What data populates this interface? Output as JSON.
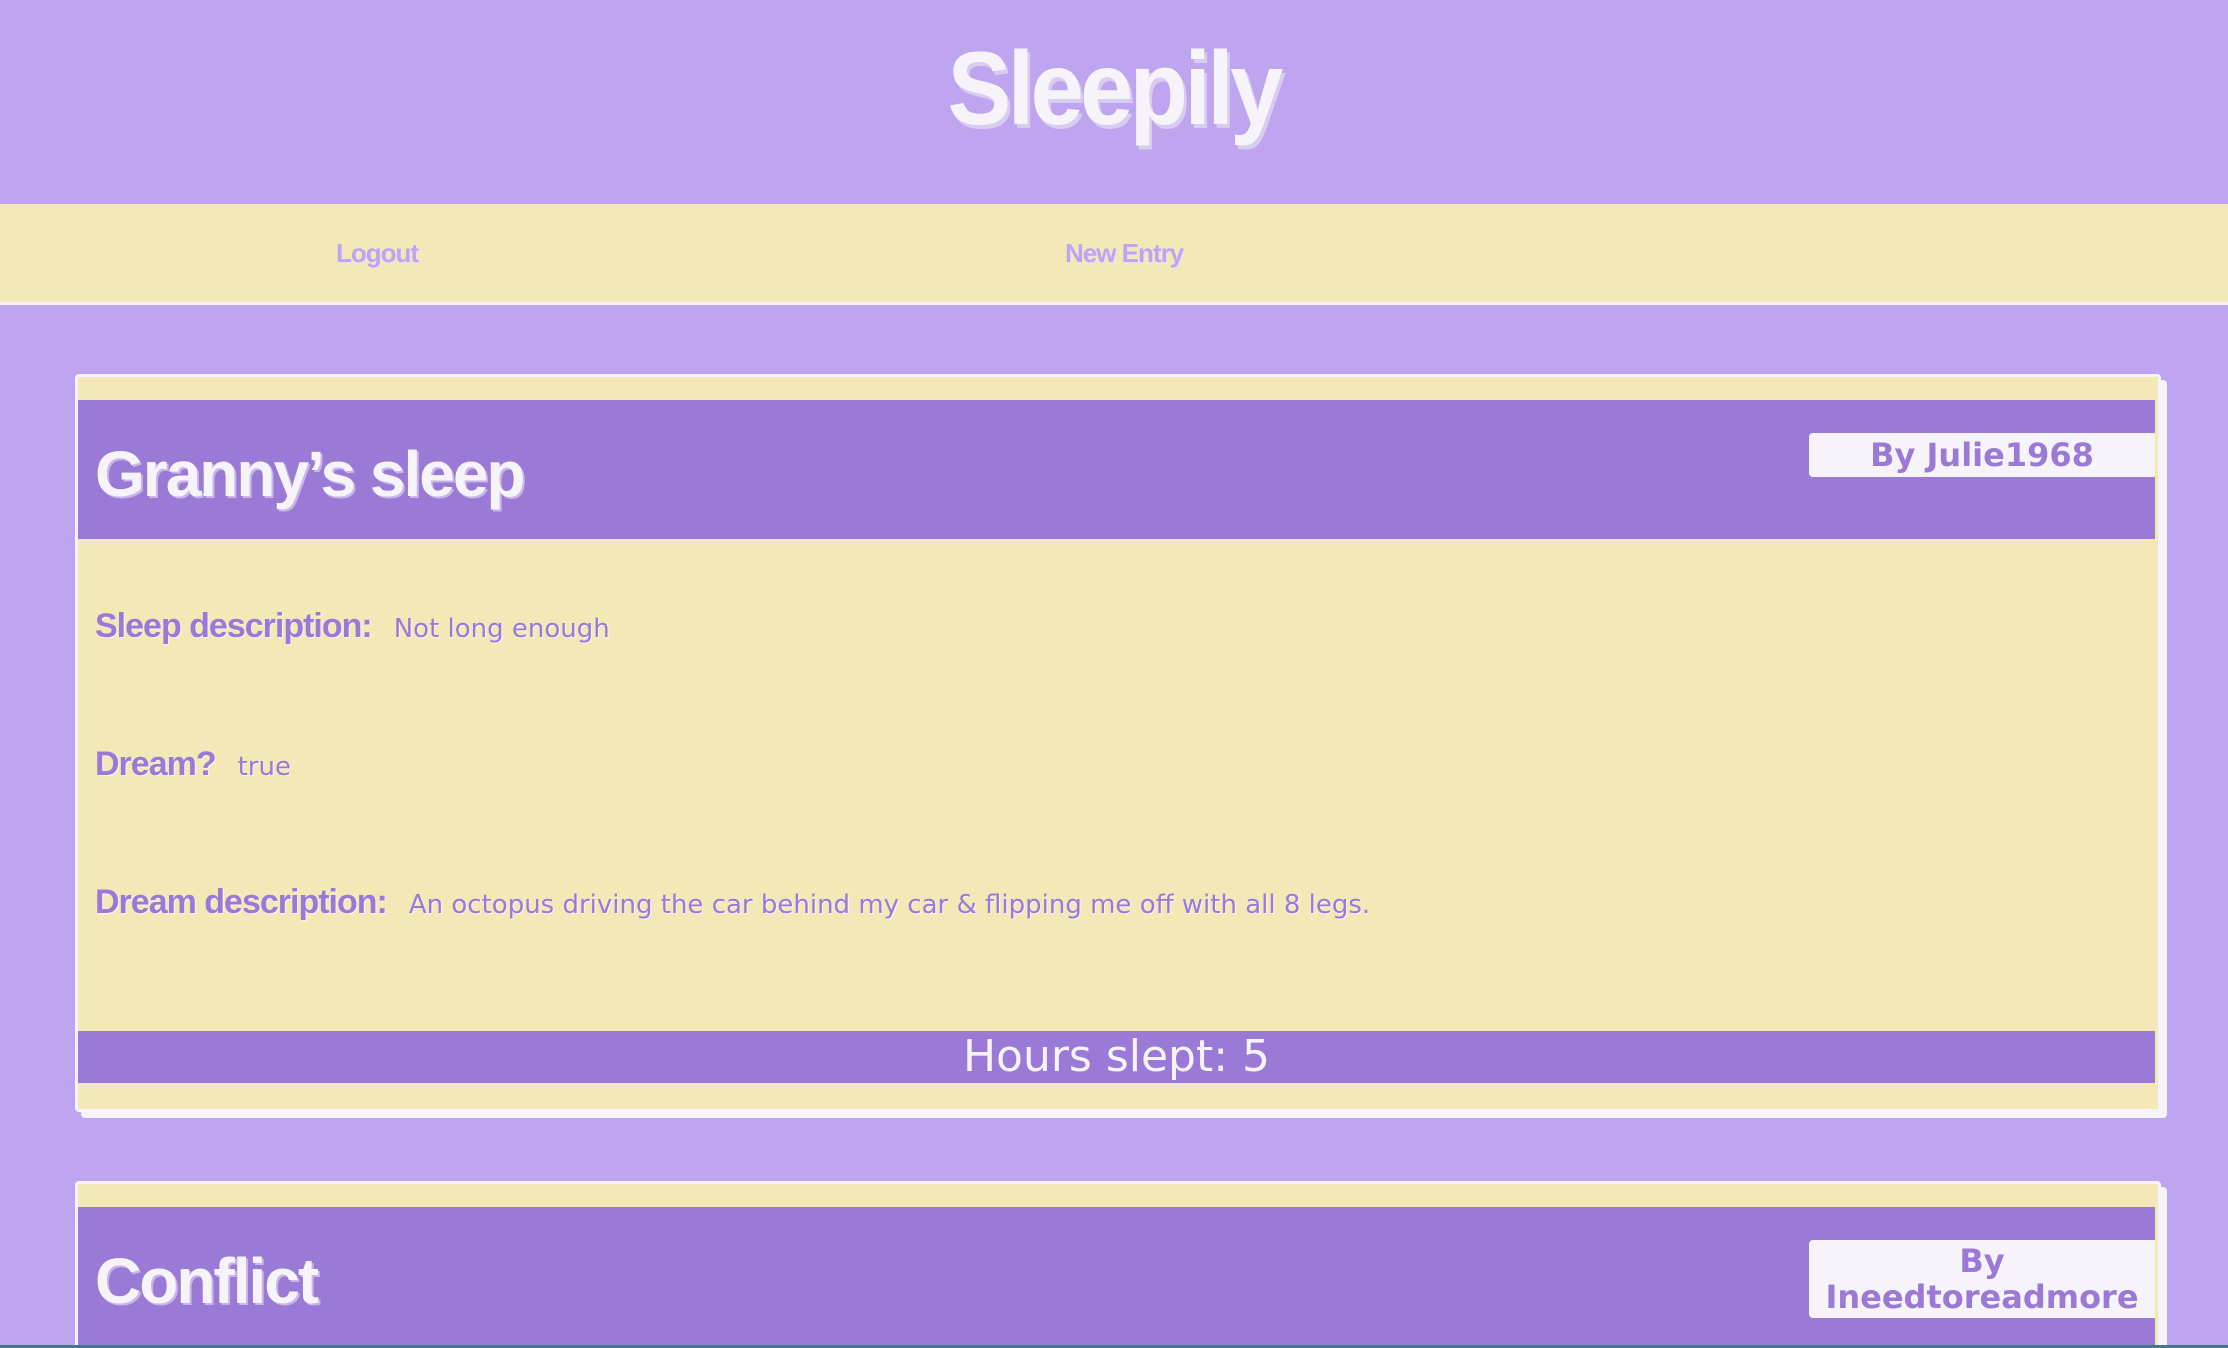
{
  "site": {
    "title": "Sleepily"
  },
  "nav": {
    "logout": "Logout",
    "new_entry": "New Entry"
  },
  "entries": [
    {
      "title": "Granny’s sleep",
      "author": "By Julie1968",
      "sleep_description_label": "Sleep description:",
      "sleep_description": "Not long enough",
      "dream_label": "Dream?",
      "dream": "true",
      "dream_description_label": "Dream description:",
      "dream_description": "An octopus driving the car behind my car & flipping me off with all 8 legs.",
      "hours_slept": "Hours slept: 5"
    },
    {
      "title": "Conflict",
      "author_line1": "By",
      "author_line2": "Ineedtoreadmore"
    }
  ],
  "colors": {
    "background": "#bfa4f0",
    "accent": "#9b79d6",
    "panel": "#f4e8b7",
    "white": "#f6f3fb"
  }
}
